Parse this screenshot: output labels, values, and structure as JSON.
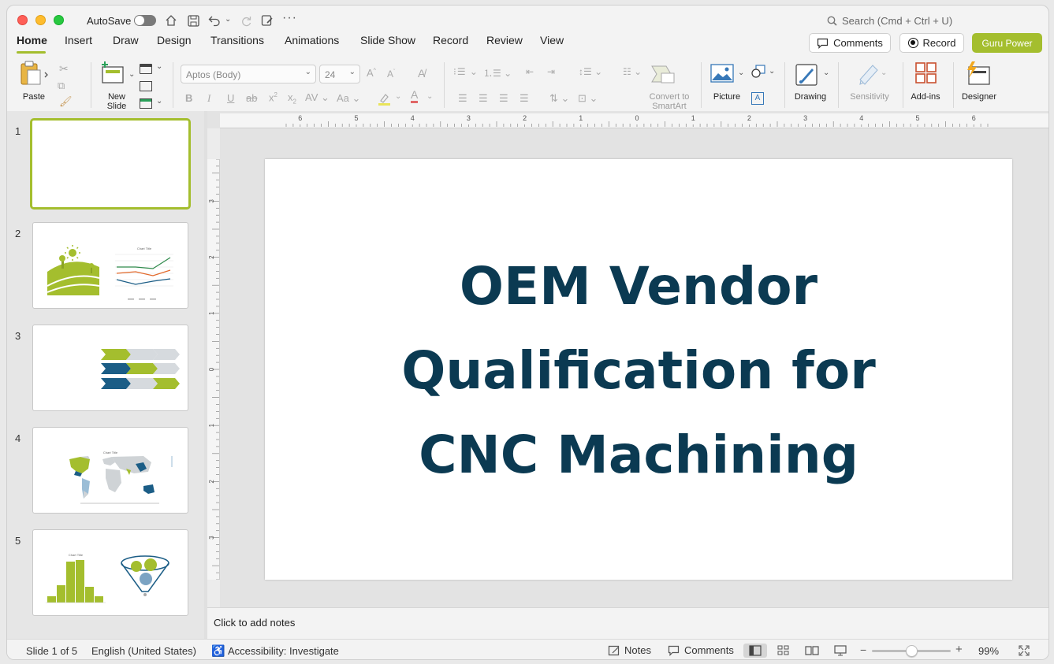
{
  "titlebar": {
    "autosave_label": "AutoSave",
    "search_placeholder": "Search (Cmd + Ctrl + U)"
  },
  "tabs": [
    "Home",
    "Insert",
    "Draw",
    "Design",
    "Transitions",
    "Animations",
    "Slide Show",
    "Record",
    "Review",
    "View"
  ],
  "actions": {
    "comments": "Comments",
    "record": "Record",
    "guru": "Guru Power"
  },
  "ribbon": {
    "paste": "Paste",
    "new_slide_1": "New",
    "new_slide_2": "Slide",
    "font_name": "Aptos (Body)",
    "font_size": "24",
    "convert_1": "Convert to",
    "convert_2": "SmartArt",
    "picture": "Picture",
    "drawing": "Drawing",
    "sensitivity": "Sensitivity",
    "addins": "Add-ins",
    "designer": "Designer"
  },
  "colors": {
    "accent_green": "#a4be2e",
    "title_navy": "#0b3a52",
    "series_blue": "#1b5d86"
  },
  "thumbnails": [
    {
      "number": "1",
      "selected": true
    },
    {
      "number": "2",
      "chart_title": "Chart Title"
    },
    {
      "number": "3"
    },
    {
      "number": "4",
      "chart_title": "Chart Title"
    },
    {
      "number": "5",
      "chart_title": "Chart Title"
    }
  ],
  "ruler": {
    "h_ticks": [
      "6",
      "5",
      "4",
      "3",
      "2",
      "1",
      "0",
      "1",
      "2",
      "3",
      "4",
      "5",
      "6"
    ],
    "v_ticks": [
      "3",
      "2",
      "1",
      "0",
      "1",
      "2",
      "3"
    ]
  },
  "slide": {
    "title_lines": [
      "OEM Vendor",
      "Qualification for",
      "CNC Machining"
    ]
  },
  "notes": {
    "placeholder": "Click to add notes"
  },
  "status": {
    "slide_count": "Slide 1 of 5",
    "language": "English (United States)",
    "accessibility": "Accessibility: Investigate",
    "notes": "Notes",
    "comments": "Comments",
    "zoom": "99%",
    "zoom_level": 0.5
  }
}
